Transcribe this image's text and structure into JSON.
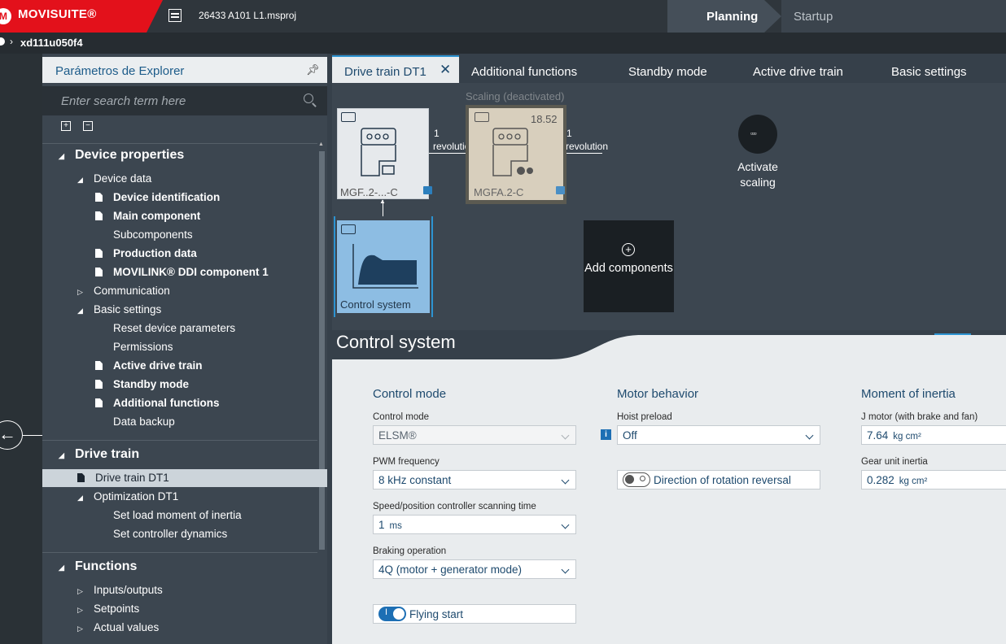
{
  "app": {
    "brand": "MOVISUITE®",
    "project_file": "26433 A101 L1.msproj",
    "modes": {
      "planning": "Planning",
      "startup": "Startup"
    },
    "device": "xd111u050f4",
    "colors": {
      "brand_red": "#e3111b",
      "accent_blue": "#2c93d1",
      "text_blue": "#1e4a6e"
    }
  },
  "explorer": {
    "title": "Parámetros de Explorer",
    "search_placeholder": "Enter search term here",
    "sections": [
      {
        "label": "Device properties"
      },
      {
        "label": "Drive train"
      },
      {
        "label": "Functions"
      }
    ],
    "items": {
      "device_data": "Device data",
      "device_identification": "Device identification",
      "main_component": "Main component",
      "subcomponents": "Subcomponents",
      "production_data": "Production data",
      "movilink_ddi": "MOVILINK® DDI component 1",
      "communication": "Communication",
      "basic_settings": "Basic settings",
      "reset_device_parameters": "Reset device parameters",
      "permissions": "Permissions",
      "active_drive_train": "Active drive train",
      "standby_mode": "Standby mode",
      "additional_functions": "Additional functions",
      "data_backup": "Data backup",
      "drive_train_dt1": "Drive train DT1",
      "optimization_dt1": "Optimization DT1",
      "set_load_moment": "Set load moment of inertia",
      "set_controller_dynamics": "Set controller dynamics",
      "inputs_outputs": "Inputs/outputs",
      "setpoints": "Setpoints",
      "actual_values": "Actual values"
    }
  },
  "tabs": [
    {
      "label": "Drive train DT1",
      "active": true
    },
    {
      "label": "Additional functions"
    },
    {
      "label": "Standby mode"
    },
    {
      "label": "Active drive train"
    },
    {
      "label": "Basic settings"
    }
  ],
  "canvas": {
    "motor_label": "MGF..2-...-C",
    "gear_label": "MGFA.2-C",
    "scaling_label": "Scaling (deactivated)",
    "ratio": "18.52",
    "link_count": "1",
    "link_unit": "revolution",
    "control_label": "Control system",
    "activate_scaling": "Activate scaling",
    "add_components": "Add components"
  },
  "panel": {
    "title": "Control system",
    "control_mode": {
      "heading": "Control mode",
      "control_mode_label": "Control mode",
      "control_mode_value": "ELSM®",
      "pwm_label": "PWM frequency",
      "pwm_value": "8 kHz constant",
      "scan_label": "Speed/position controller scanning time",
      "scan_value": "1",
      "scan_unit": "ms",
      "braking_label": "Braking operation",
      "braking_value": "4Q (motor + generator mode)",
      "flying_start": "Flying start",
      "flying_start_on": true
    },
    "motor_behavior": {
      "heading": "Motor behavior",
      "hoist_label": "Hoist preload",
      "hoist_value": "Off",
      "direction_reversal": "Direction of rotation reversal",
      "direction_reversal_on": false
    },
    "inertia": {
      "heading": "Moment of inertia",
      "j_motor_label": "J motor (with brake and fan)",
      "j_motor_value": "7.64",
      "j_motor_unit": "kg cm²",
      "gear_label": "Gear unit inertia",
      "gear_value": "0.282",
      "gear_unit": "kg cm²"
    }
  }
}
